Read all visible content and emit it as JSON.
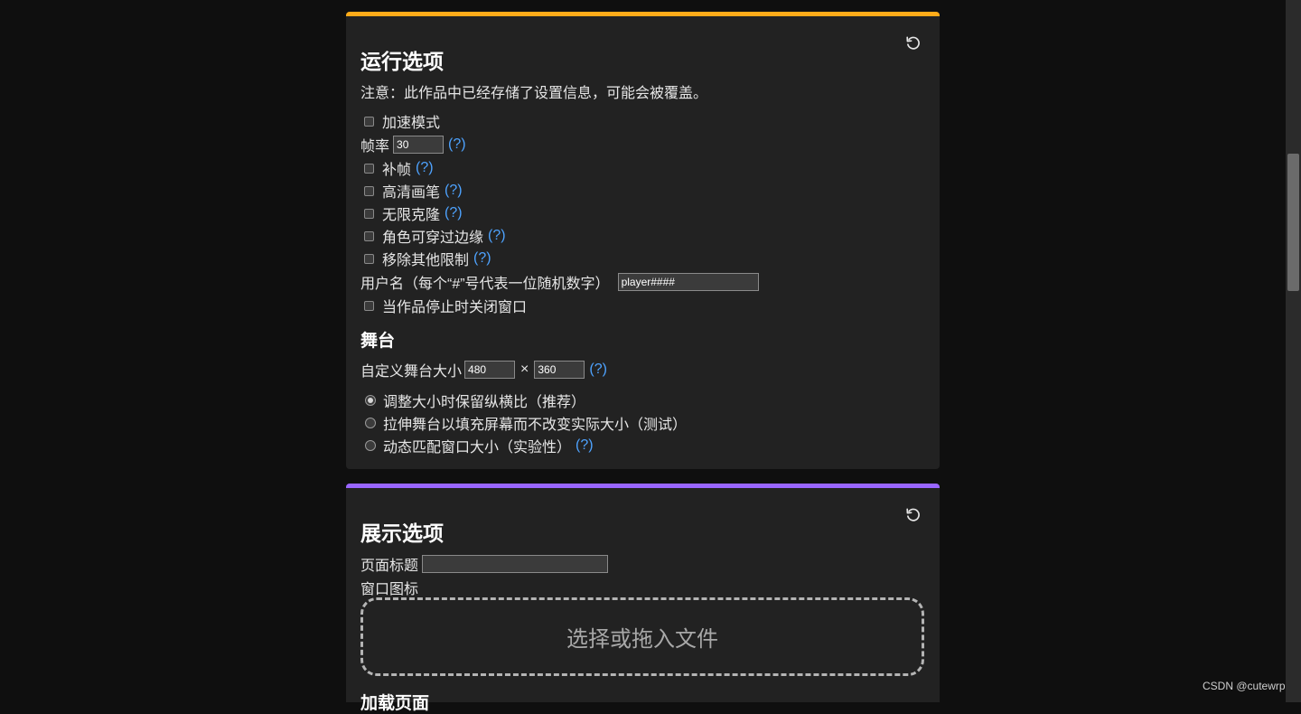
{
  "colors": {
    "run_accent": "#ffab19",
    "display_accent": "#9966ff",
    "help_link": "#4ea3ff"
  },
  "icons": {
    "reset": "reset-icon"
  },
  "run_options": {
    "title": "运行选项",
    "notice": "注意：此作品中已经存储了设置信息，可能会被覆盖。",
    "turbo_label": "加速模式",
    "turbo_checked": false,
    "framerate_label": "帧率",
    "framerate_value": "30",
    "help_text": "(?)",
    "interpolation_label": "补帧",
    "interpolation_checked": false,
    "hq_pen_label": "高清画笔",
    "hq_pen_checked": false,
    "infinite_clones_label": "无限克隆",
    "infinite_clones_checked": false,
    "fencing_label": "角色可穿过边缘",
    "fencing_checked": false,
    "misc_limits_label": "移除其他限制",
    "misc_limits_checked": false,
    "username_label": "用户名（每个“#”号代表一位随机数字）",
    "username_value": "player####",
    "close_when_stopped_label": "当作品停止时关闭窗口",
    "close_when_stopped_checked": false,
    "stage_heading": "舞台",
    "custom_stage_size_label": "自定义舞台大小",
    "stage_width": "480",
    "stage_height": "360",
    "times_sign": "×",
    "resize_options": [
      {
        "label": "调整大小时保留纵横比（推荐）",
        "selected": true
      },
      {
        "label": "拉伸舞台以填充屏幕而不改变实际大小（测试）",
        "selected": false
      },
      {
        "label": "动态匹配窗口大小（实验性）",
        "selected": false
      }
    ]
  },
  "display_options": {
    "title": "展示选项",
    "page_title_label": "页面标题",
    "page_title_value": "",
    "window_icon_label": "窗口图标",
    "dropzone_text": "选择或拖入文件",
    "loading_screen_heading": "加载页面"
  },
  "watermark": "CSDN @cutewrp"
}
